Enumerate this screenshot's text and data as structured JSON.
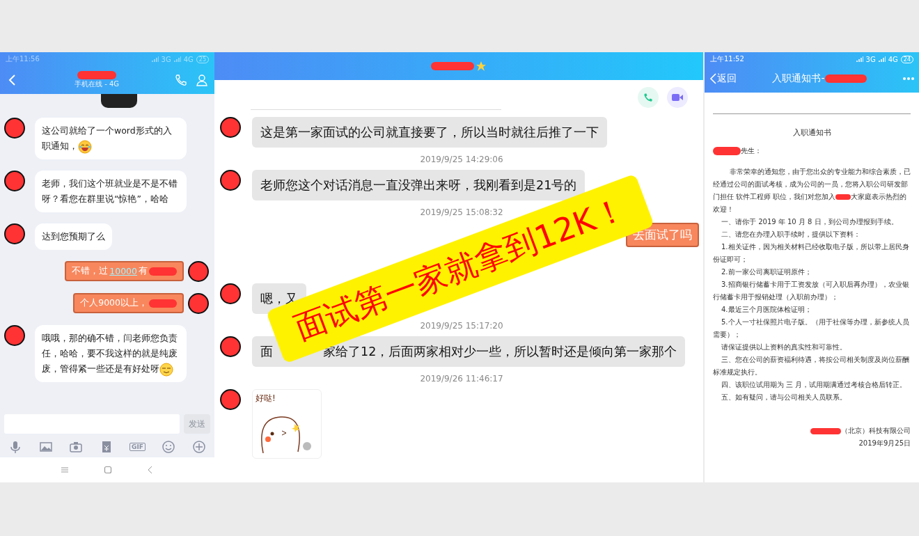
{
  "left_chat": {
    "status_bar": {
      "time": "上午11:56",
      "network_1": "3G",
      "network_2": "4G",
      "battery": "25"
    },
    "header": {
      "subtitle": "手机在线 - 4G"
    },
    "messages": [
      {
        "kind": "laughing",
        "text": "这公司就给了一个word形式的入职通知，"
      },
      {
        "kind": "incoming",
        "text": "老师，我们这个班就业是不是不错呀？看您在群里说“惊艳”，哈哈"
      },
      {
        "kind": "incoming",
        "text": "达到您预期了么"
      },
      {
        "kind": "outgoing",
        "text": "不错，过",
        "link": "10000",
        "after": "有"
      },
      {
        "kind": "outgoing",
        "text": "个人9000以上，"
      },
      {
        "kind": "smirking",
        "text": "哦哦，那的确不错，闫老师您负责任，哈哈，要不我这样的就是纯废废，管得紧一些还是有好处呀"
      }
    ],
    "send_button": "发送",
    "gif_label": "GIF"
  },
  "middle_chat": {
    "messages": [
      {
        "kind": "incoming",
        "text": "这是第一家面试的公司就直接要了，所以当时就往后推了一下"
      },
      {
        "kind": "time",
        "text": "2019/9/25 14:29:06"
      },
      {
        "kind": "incoming",
        "text": "老师您这个对话消息一直没弹出来呀，我刚看到是21号的"
      },
      {
        "kind": "time",
        "text": "2019/9/25 15:08:32"
      },
      {
        "kind": "outgoing",
        "text": "去面试了吗"
      },
      {
        "kind": "incoming",
        "text": "嗯，又"
      },
      {
        "kind": "time",
        "text": "2019/9/25 15:17:20"
      },
      {
        "kind": "incoming",
        "text": "面",
        "after": "家给了12，后面两家相对少一些，所以暂时还是倾向第一家那个"
      },
      {
        "kind": "time",
        "text": "2019/9/26 11:46:17"
      },
      {
        "kind": "sticker",
        "text": "好哒!"
      }
    ]
  },
  "banner": {
    "text": "面试第一家就拿到12K！"
  },
  "document_view": {
    "status_bar": {
      "time": "上午11:52",
      "network_1": "3G",
      "network_2": "4G",
      "battery": "24"
    },
    "back_button": "返回",
    "title": "入职通知书-",
    "doc_title": "入职通知书",
    "salutation": "先生：",
    "paragraphs": [
      {
        "kind": "lead",
        "text": "非常荣幸的通知您，由于您出众的专业能力和综合素质，已经通过公司的面试考核，成为公司的一员，您将入职公司研发部门担任 软件工程师 职位，我们对您加入",
        "after": "大家庭表示热烈的欢迎！"
      },
      {
        "kind": "item",
        "text": "一、请你于 2019 年 10 月 8 日，到公司办理报到手续。"
      },
      {
        "kind": "item",
        "text": "二、请您在办理入职手续时，提供以下资料："
      },
      {
        "kind": "item",
        "text": "1.相关证件，因为相关材料已经收取电子版，所以带上居民身份证即可；"
      },
      {
        "kind": "item",
        "text": "2.前一家公司离职证明原件；"
      },
      {
        "kind": "item",
        "text": "3.招商银行储蓄卡用于工资发放（可入职后再办理），农业银行储蓄卡用于报销处理（入职前办理）；"
      },
      {
        "kind": "item",
        "text": "4.最近三个月医院体检证明；"
      },
      {
        "kind": "item",
        "text": "5.个人一寸社保照片电子版。（用于社保等办理，新参统人员需要）；"
      },
      {
        "kind": "item",
        "text": "请保证提供以上资料的真实性和可靠性。"
      },
      {
        "kind": "item",
        "text": "三、您在公司的薪资福利待遇，将按公司相关制度及岗位薪酬标准规定执行。"
      },
      {
        "kind": "item",
        "text": "四、该职位试用期为 三 月，试用期满通过考核合格后转正。"
      },
      {
        "kind": "item",
        "text": "五、如有疑问，请与公司相关人员联系。"
      }
    ],
    "company": "（北京）科技有限公司",
    "date": "2019年9月25日"
  }
}
